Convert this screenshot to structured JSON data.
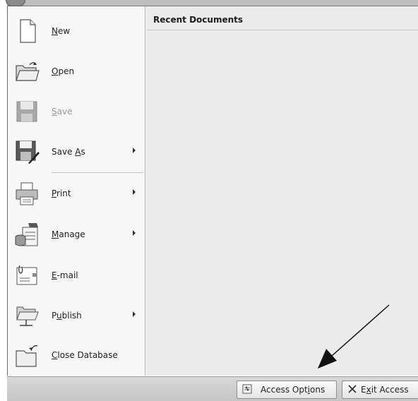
{
  "menu": {
    "items": [
      {
        "label": "New",
        "key": "N",
        "has_submenu": false,
        "disabled": false,
        "icon": "new-document-icon"
      },
      {
        "label": "Open",
        "key": "O",
        "has_submenu": false,
        "disabled": false,
        "icon": "open-folder-icon"
      },
      {
        "label": "Save",
        "key": "S",
        "has_submenu": false,
        "disabled": true,
        "icon": "save-icon"
      },
      {
        "label": "Save As",
        "key": "A",
        "has_submenu": true,
        "disabled": false,
        "icon": "save-as-icon"
      },
      {
        "label": "Print",
        "key": "P",
        "has_submenu": true,
        "disabled": false,
        "icon": "printer-icon"
      },
      {
        "label": "Manage",
        "key": "M",
        "has_submenu": true,
        "disabled": false,
        "icon": "manage-icon"
      },
      {
        "label": "E-mail",
        "key": "E",
        "has_submenu": false,
        "disabled": false,
        "icon": "email-icon"
      },
      {
        "label": "Publish",
        "key": "u",
        "has_submenu": true,
        "disabled": false,
        "icon": "publish-icon"
      },
      {
        "label": "Close Database",
        "key": "C",
        "has_submenu": false,
        "disabled": false,
        "icon": "close-database-icon"
      }
    ]
  },
  "recent": {
    "title": "Recent Documents",
    "documents": []
  },
  "footer": {
    "options_button": {
      "label": "Access Options",
      "key": "i",
      "icon": "options-icon"
    },
    "exit_button": {
      "label": "Exit Access",
      "key": "x",
      "icon": "close-x-icon"
    }
  }
}
